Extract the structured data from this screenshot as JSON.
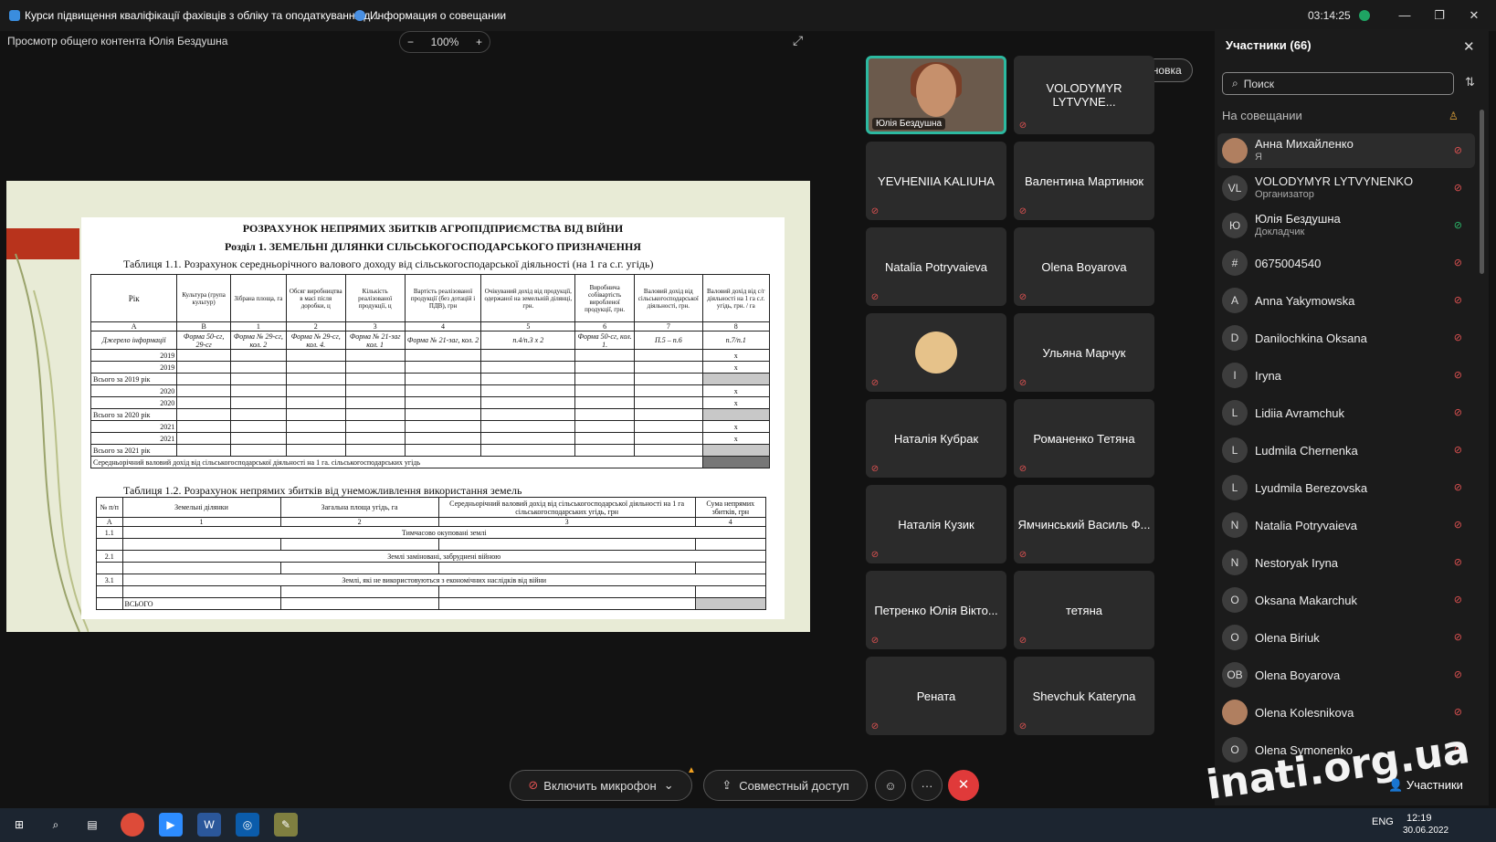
{
  "titlebar": {
    "tab1": "Курси підвищення кваліфікації фахівців з обліку та оподаткування д...",
    "tab2": "Информация о совещании",
    "timer": "03:14:25",
    "minimize": "—",
    "restore": "❐",
    "close": "✕"
  },
  "viewer": {
    "label": "Просмотр общего контента Юлія Бездушна",
    "zoom_out": "−",
    "zoom_value": "100%",
    "zoom_in": "+",
    "expand": "⤢"
  },
  "slide": {
    "title1": "РОЗРАХУНОК НЕПРЯМИХ ЗБИТКІВ АГРОПІДПРИЄМСТВА ВІД ВІЙНИ",
    "title2": "Розділ 1. ЗЕМЕЛЬНІ ДІЛЯНКИ СІЛЬСЬКОГОСПОДАРСЬКОГО ПРИЗНАЧЕННЯ",
    "table1_caption": "Таблиця 1.1. Розрахунок середньорічного валового доходу від сільськогосподарської діяльності (на 1 га с.г. угідь)",
    "table1_headers": [
      "Рік",
      "Культура (група культур)",
      "Зібрана площа, га",
      "Обсяг виробництва в масі після доробки, ц",
      "Кількість реалізованої продукції, ц",
      "Вартість реалізованої продукції (без дотацій і ПДВ), грн",
      "Очікуваний дохід від продукції, одержаної на земельній ділянці, грн.",
      "Виробнича собівартість виробленої продукції, грн.",
      "Валовий дохід від сільськогосподарської діяльності, грн.",
      "Валовий дохід від с/г діяльності на 1 га с.г. угідь, грн. / га"
    ],
    "table1_index": [
      "А",
      "В",
      "1",
      "2",
      "3",
      "4",
      "5",
      "6",
      "7",
      "8"
    ],
    "table1_source": [
      "Джерело інформації",
      "Форма 50-сг, 29-сг",
      "Форма № 29-сг, кол. 2",
      "Форма № 29-сг, кол. 4.",
      "Форма № 21-заг кол. 1",
      "Форма № 21-заг, кол. 2",
      "п.4/п.3 х 2",
      "Форма 50-сг, кол. 1.",
      "П.5 – п.6",
      "п.7/п.1"
    ],
    "table1_rows": [
      "2019",
      "2019",
      "Всього за 2019 рік",
      "2020",
      "2020",
      "Всього за 2020 рік",
      "2021",
      "2021",
      "Всього за 2021 рік"
    ],
    "mark_x": "x",
    "table1_footer": "Середньорічний валовий дохід від сільськогосподарської діяльності на 1 га. сільськогосподарських угідь",
    "table2_caption": "Таблиця 1.2. Розрахунок непрямих збитків від унеможливлення використання земель",
    "table2_headers": [
      "№ п/п",
      "Земельні ділянки",
      "Загальна площа угідь, га",
      "Середньорічний валовий дохід від сільськогосподарської діяльності на 1 га сільськогосподарських угідь, грн",
      "Сума непрямих збитків, грн"
    ],
    "table2_index": [
      "А",
      "1",
      "2",
      "3",
      "4"
    ],
    "table2_rows": [
      {
        "num": "1.1",
        "text": "Тимчасово окуповані землі"
      },
      {
        "num": "2.1",
        "text": "Землі заміновані, забруднені війною"
      },
      {
        "num": "3.1",
        "text": "Землі, які не використовуються з економічних наслідків від війни"
      }
    ],
    "table2_total": "ВСЬОГО"
  },
  "video": {
    "layout_button": "Компоновка",
    "self_name": "Юлія Бездушна",
    "tiles": [
      "VOLODYMYR LYTVYNE...",
      "YEVHENIIA KALIUHA",
      "Валентина Мартинюк",
      "Natalia Potryvaieva",
      "Olena Boyarova",
      "",
      "Ульяна Марчук",
      "Наталія Кубрак",
      "Романенко Тетяна",
      "Наталія Кузик",
      "Ямчинський Василь Ф...",
      "Петренко Юлія Вікто...",
      "тетяна",
      "Рената",
      "Shevchuk Kateryna"
    ]
  },
  "participants": {
    "title": "Участники (66)",
    "search_placeholder": "Поиск",
    "section": "На совещании",
    "list": [
      {
        "initials": "",
        "name": "Анна Михайленко",
        "role": "Я",
        "photo": true
      },
      {
        "initials": "VL",
        "name": "VOLODYMYR LYTVYNENKO",
        "role": "Организатор"
      },
      {
        "initials": "Ю",
        "name": "Юлія Бездушна",
        "role": "Докладчик"
      },
      {
        "initials": "#",
        "name": "0675004540",
        "role": ""
      },
      {
        "initials": "A",
        "name": "Anna Yakymowska",
        "role": ""
      },
      {
        "initials": "D",
        "name": "Danilochkina Oksana",
        "role": ""
      },
      {
        "initials": "I",
        "name": "Iryna",
        "role": ""
      },
      {
        "initials": "L",
        "name": "Lidiia Avramchuk",
        "role": ""
      },
      {
        "initials": "L",
        "name": "Ludmila Chernenka",
        "role": ""
      },
      {
        "initials": "L",
        "name": "Lyudmila Berezovska",
        "role": ""
      },
      {
        "initials": "N",
        "name": "Natalia Potryvaieva",
        "role": ""
      },
      {
        "initials": "N",
        "name": "Nestoryak Iryna",
        "role": ""
      },
      {
        "initials": "O",
        "name": "Oksana Makarchuk",
        "role": ""
      },
      {
        "initials": "O",
        "name": "Olena Biriuk",
        "role": ""
      },
      {
        "initials": "OB",
        "name": "Olena Boyarova",
        "role": ""
      },
      {
        "initials": "",
        "name": "Olena Kolesnikova",
        "role": "",
        "photo": true
      },
      {
        "initials": "O",
        "name": "Olena Symonenko",
        "role": ""
      }
    ]
  },
  "controls": {
    "mic": "Включить микрофон",
    "share": "Совместный доступ",
    "more": "···",
    "end": "✕",
    "participants_btn": "Участники"
  },
  "taskbar": {
    "lang": "ENG",
    "time": "12:19",
    "date": "30.06.2022"
  },
  "watermark": "inati.org.ua",
  "colors": {
    "accent": "#2cb9a0",
    "end": "#e03a3a",
    "muted": "#e05252"
  }
}
